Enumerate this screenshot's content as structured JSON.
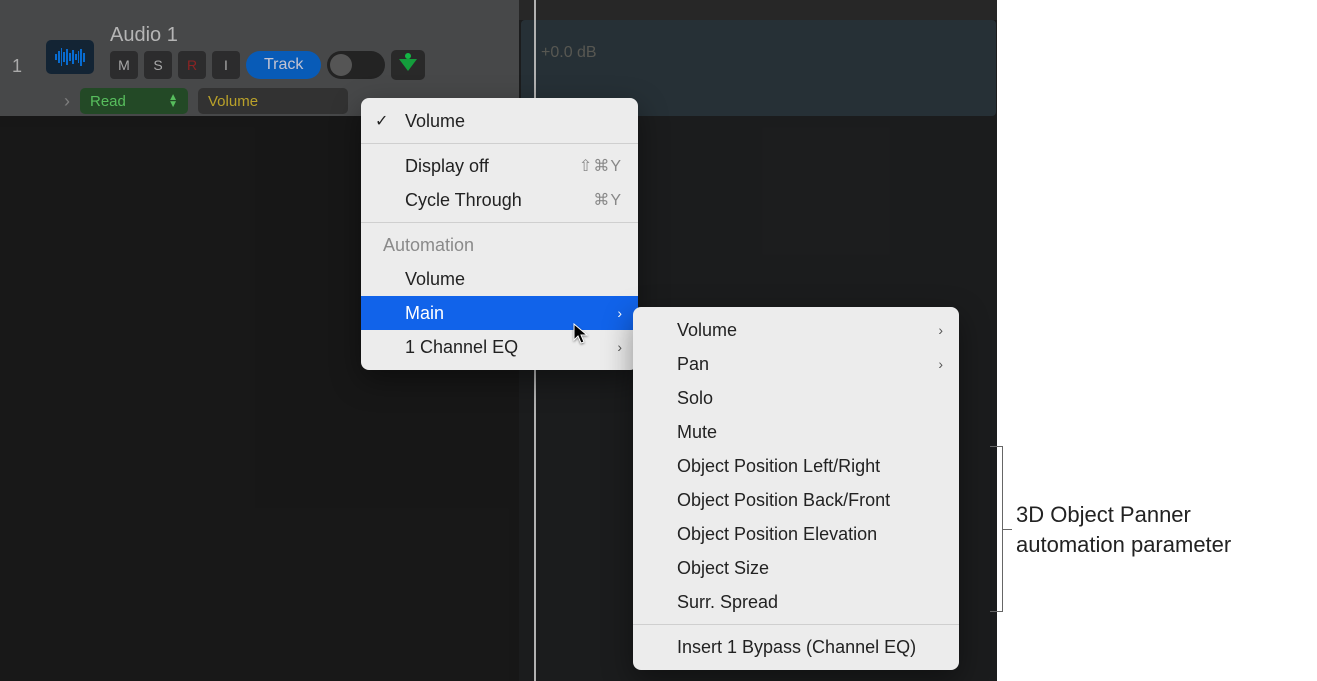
{
  "track": {
    "number": "1",
    "name": "Audio 1",
    "buttons": {
      "m": "M",
      "s": "S",
      "r": "R",
      "i": "I",
      "track": "Track"
    },
    "automation_mode": "Read",
    "parameter": "Volume"
  },
  "timeline": {
    "db_label": "+0.0 dB"
  },
  "menu1": {
    "checked_item": "Volume",
    "items_display": [
      {
        "label": "Display off",
        "shortcut": "⇧⌘Y"
      },
      {
        "label": "Cycle Through",
        "shortcut": "⌘Y"
      }
    ],
    "section_header": "Automation",
    "items_auto": [
      {
        "label": "Volume",
        "submenu": false
      },
      {
        "label": "Main",
        "submenu": true,
        "highlighted": true
      },
      {
        "label": "1 Channel EQ",
        "submenu": true
      }
    ]
  },
  "menu2": {
    "items_top": [
      {
        "label": "Volume",
        "submenu": true
      },
      {
        "label": "Pan",
        "submenu": true
      },
      {
        "label": "Solo"
      },
      {
        "label": "Mute"
      },
      {
        "label": "Object Position Left/Right"
      },
      {
        "label": "Object Position Back/Front"
      },
      {
        "label": "Object Position Elevation"
      },
      {
        "label": "Object Size"
      },
      {
        "label": "Surr. Spread"
      }
    ],
    "items_bottom": [
      {
        "label": "Insert 1 Bypass (Channel EQ)"
      }
    ]
  },
  "callout": {
    "line1": "3D Object Panner",
    "line2": "automation parameter"
  }
}
